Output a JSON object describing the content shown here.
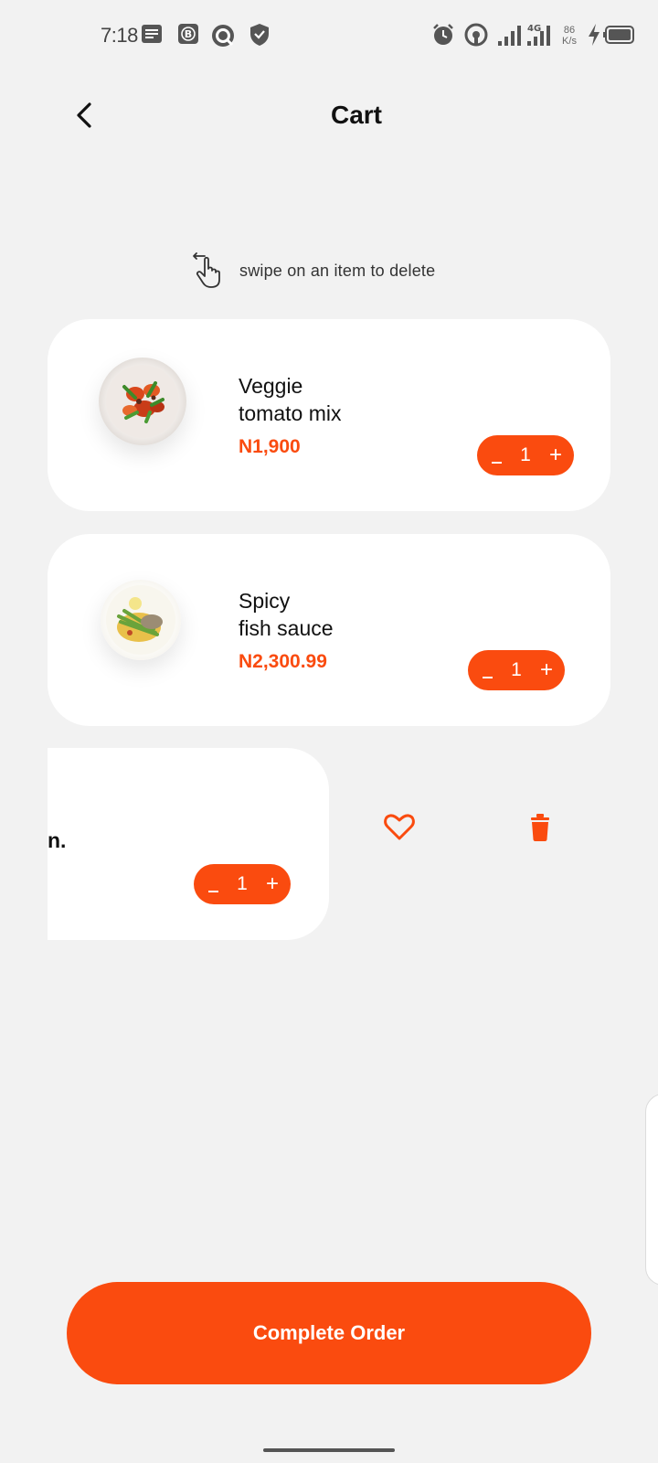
{
  "status_bar": {
    "time": "7:18",
    "network_type": "4G",
    "net_speed_value": "86",
    "net_speed_unit": "K/s",
    "icons": [
      "message-icon",
      "b-app-icon",
      "q-app-icon",
      "shield-icon",
      "alarm-icon",
      "hotspot-icon",
      "signal-icon",
      "signal-4g-icon",
      "charging-icon",
      "battery-icon"
    ]
  },
  "header": {
    "title": "Cart",
    "back_icon": "chevron-left-icon"
  },
  "hint": {
    "text": "swipe on an item to delete",
    "icon": "swipe-hand-icon"
  },
  "cart": {
    "items": [
      {
        "name_line1": "Veggie",
        "name_line2": "tomato mix",
        "price": "N1,900",
        "quantity": "1"
      },
      {
        "name_line1": "Spicy",
        "name_line2": "fish sauce",
        "price": "N2,300.99",
        "quantity": "1"
      },
      {
        "name_visible_fragment": "n.",
        "quantity": "1",
        "swiped": true
      }
    ],
    "qty_minus": "-",
    "qty_plus": "+"
  },
  "swipe_actions": {
    "favorite_icon": "heart-icon",
    "delete_icon": "trash-icon"
  },
  "checkout": {
    "button_label": "Complete Order"
  },
  "colors": {
    "accent": "#fa4b0f",
    "background": "#f2f2f2",
    "card": "#ffffff"
  }
}
